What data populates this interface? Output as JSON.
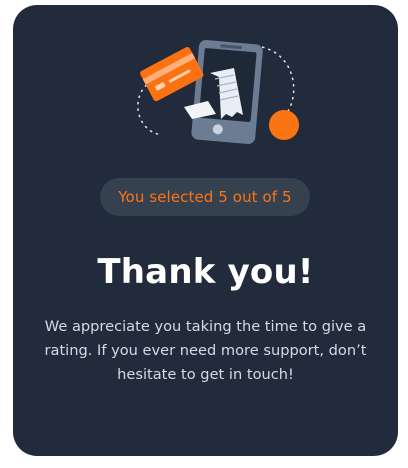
{
  "card": {
    "background": "#222b3b",
    "illustration_icon": "card-payment-receipt-phone-icon",
    "badge": {
      "text": "You selected 5 out of 5",
      "color": "#fb7413",
      "background": "#364150"
    },
    "title": "Thank you!",
    "message": "We appreciate you taking the time to give a rating. If you ever need more support, don’t hesitate to get in touch!"
  },
  "colors": {
    "accent_orange": "#fb7413",
    "text_white": "#ffffff",
    "text_muted": "#d5dbe3"
  }
}
